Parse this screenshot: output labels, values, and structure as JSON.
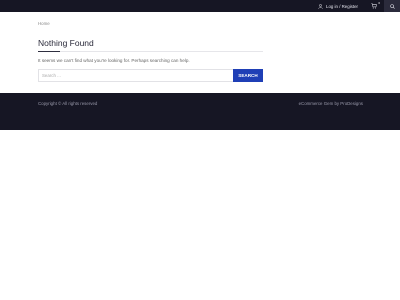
{
  "topbar": {
    "login_label": "Log in / Register",
    "cart_count": "0"
  },
  "breadcrumb": "Home",
  "main": {
    "title": "Nothing Found",
    "notice": "It seems we can't find what you're looking for. Perhaps searching can help.",
    "search_placeholder": "Search ...",
    "search_button": "SEARCH"
  },
  "footer": {
    "copyright": "Copyright © All rights reserved",
    "credit": "eCommerce Gem by ProDesigns"
  },
  "colors": {
    "dark_bar": "#161624",
    "accent": "#1f3fb6"
  },
  "icons": [
    "user-icon",
    "cart-icon",
    "search-icon"
  ]
}
